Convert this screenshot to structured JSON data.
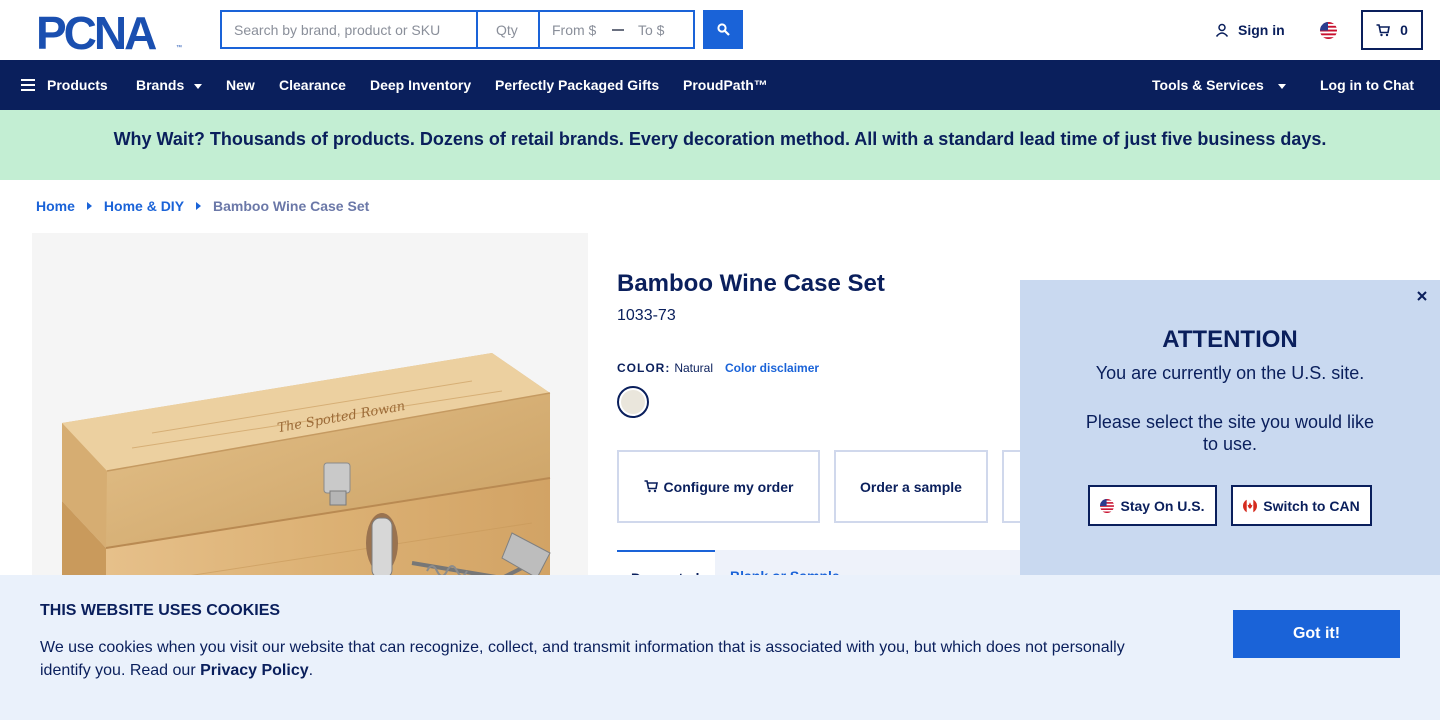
{
  "header": {
    "logo_text": "PCNA",
    "search": {
      "main_placeholder": "Search by brand, product or SKU",
      "qty_placeholder": "Qty",
      "from_placeholder": "From $",
      "to_placeholder": "To $"
    },
    "signin_label": "Sign in",
    "cart_count": "0"
  },
  "nav": {
    "products": "Products",
    "brands": "Brands",
    "new": "New",
    "clearance": "Clearance",
    "deep_inventory": "Deep Inventory",
    "gifts": "Perfectly Packaged Gifts",
    "proudpath": "ProudPath™",
    "tools": "Tools & Services",
    "chat": "Log in to Chat"
  },
  "promo": "Why Wait? Thousands of products. Dozens of retail brands. Every decoration method. All with a standard lead time of just five business days.",
  "breadcrumb": [
    "Home",
    "Home & DIY",
    "Bamboo Wine Case Set"
  ],
  "product": {
    "title": "Bamboo Wine Case Set",
    "sku": "1033-73",
    "color_label": "COLOR:",
    "color_value": "Natural",
    "color_disclaimer": "Color disclaimer",
    "image_brand_text": "The Spotted Rowan",
    "configure_label": "Configure my order",
    "sample_label": "Order a sample",
    "tab_active": "Decorated",
    "tab_other": "Blank or Sample"
  },
  "modal": {
    "title": "ATTENTION",
    "line1": "You are currently on the U.S. site.",
    "line2": "Please select the site you would like to use.",
    "stay_label": "Stay On U.S.",
    "switch_label": "Switch to CAN"
  },
  "cookie": {
    "title": "THIS WEBSITE USES COOKIES",
    "text": "We use cookies when you visit our website that can recognize, collect, and transmit information that is associated with you, but which does not personally identify you. Read our ",
    "link": "Privacy Policy",
    "end": ".",
    "button": "Got it!"
  },
  "colors": {
    "navy": "#0a1f5c",
    "blue": "#1a63d8",
    "promo_bg": "#c3eed3",
    "modal_bg": "#c9d9f0",
    "cookie_bg": "#eaf1fb"
  }
}
